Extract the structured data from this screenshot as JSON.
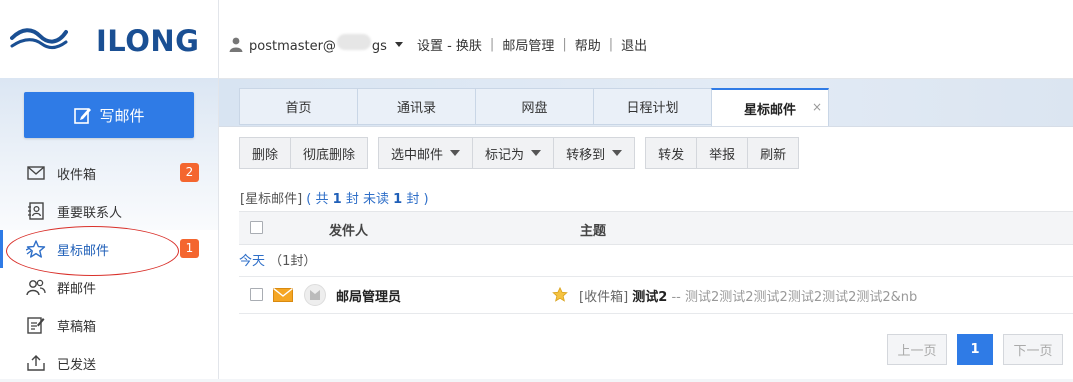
{
  "brand": {
    "name": "ILONG"
  },
  "compose": {
    "label": "写邮件"
  },
  "sidebar": {
    "items": [
      {
        "label": "收件箱",
        "badge": "2",
        "icon": "envelope-icon"
      },
      {
        "label": "重要联系人",
        "badge": "",
        "icon": "contact-card-icon"
      },
      {
        "label": "星标邮件",
        "badge": "1",
        "icon": "star-icon"
      },
      {
        "label": "群邮件",
        "badge": "",
        "icon": "group-icon"
      },
      {
        "label": "草稿箱",
        "badge": "",
        "icon": "draft-icon"
      },
      {
        "label": "已发送",
        "badge": "",
        "icon": "sent-tray-icon"
      }
    ]
  },
  "topbar": {
    "user_prefix": "postmaster@",
    "user_suffix": "gs",
    "links": [
      "设置 - 换肤",
      "邮局管理",
      "帮助",
      "退出"
    ],
    "separator": "|"
  },
  "tabs": [
    {
      "label": "首页"
    },
    {
      "label": "通讯录"
    },
    {
      "label": "网盘"
    },
    {
      "label": "日程计划"
    },
    {
      "label": "星标邮件",
      "close": "×"
    }
  ],
  "toolbar": {
    "delete": "删除",
    "delete_permanent": "彻底删除",
    "select_mail": "选中邮件",
    "mark_as": "标记为",
    "move_to": "转移到",
    "forward": "转发",
    "report": "举报",
    "refresh": "刷新"
  },
  "summary": {
    "folder": "[星标邮件]",
    "open": "(",
    "total_prefix": "共",
    "total": "1",
    "unit1": "封",
    "unread_prefix": "未读",
    "unread": "1",
    "unit2": "封",
    "close": ")"
  },
  "table": {
    "headers": {
      "sender": "发件人",
      "subject": "主题"
    }
  },
  "group": {
    "label": "今天",
    "count": "（1封）"
  },
  "mails": [
    {
      "sender": "邮局管理员",
      "folder": "[收件箱]",
      "title": "测试2",
      "dash": "--",
      "preview": "测试2测试2测试2测试2测试2测试2&nb",
      "starred": true
    }
  ],
  "pager": {
    "prev": "上一页",
    "current": "1",
    "next": "下一页"
  },
  "colors": {
    "accent": "#2f7be6",
    "badge": "#f4662f",
    "annotation": "#d9302a"
  }
}
